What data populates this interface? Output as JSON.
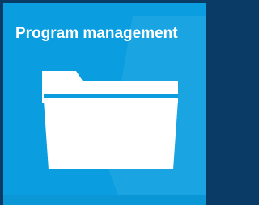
{
  "tile": {
    "title": "Program management",
    "icon": "folder-icon",
    "background_color": "#0a9ee0",
    "border_color": "#0a3a66"
  }
}
